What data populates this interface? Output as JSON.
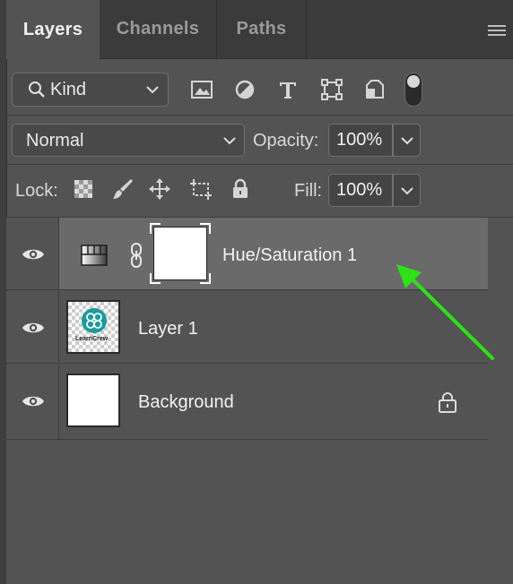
{
  "tabs": [
    {
      "label": "Layers",
      "active": true
    },
    {
      "label": "Channels",
      "active": false
    },
    {
      "label": "Paths",
      "active": false
    }
  ],
  "filter": {
    "kind_label": "Kind",
    "filter_icons": [
      "image-filter-icon",
      "adjustment-filter-icon",
      "type-filter-icon",
      "shape-filter-icon",
      "smart-object-filter-icon"
    ]
  },
  "blend": {
    "mode": "Normal",
    "opacity_label": "Opacity:",
    "opacity_value": "100%"
  },
  "lock": {
    "label": "Lock:",
    "lock_icons": [
      "lock-transparent-pixels-icon",
      "lock-image-pixels-icon",
      "lock-position-icon",
      "lock-artboard-icon",
      "lock-all-icon"
    ],
    "fill_label": "Fill:",
    "fill_value": "100%"
  },
  "layers": [
    {
      "name": "Hue/Saturation 1",
      "type": "adjustment",
      "selected": true,
      "visible": true
    },
    {
      "name": "Layer 1",
      "type": "image",
      "selected": false,
      "visible": true
    },
    {
      "name": "Background",
      "type": "background",
      "selected": false,
      "visible": true,
      "locked": true
    }
  ],
  "logo_text": "LearnCrew",
  "colors": {
    "panel_bg": "#535353",
    "selected_row": "#6a6a6a",
    "arrow": "#2ee016",
    "logo_teal": "#1a9a9c"
  }
}
